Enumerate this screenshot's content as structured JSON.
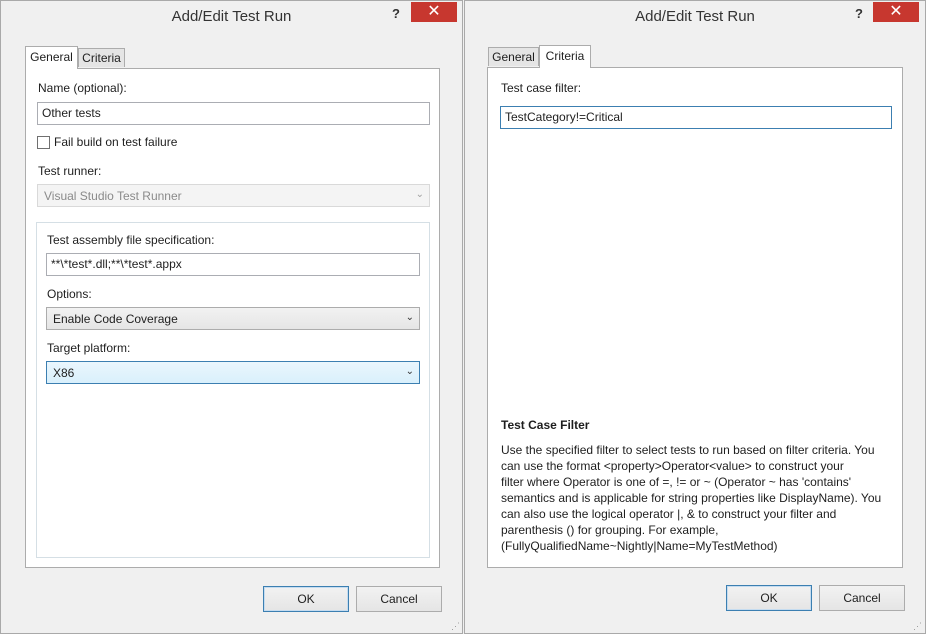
{
  "left_dialog": {
    "title": "Add/Edit Test Run",
    "help_glyph": "?",
    "close_glyph": "✕",
    "tabs": [
      {
        "label": "General",
        "active": true
      },
      {
        "label": "Criteria",
        "active": false
      }
    ],
    "name_label": "Name (optional):",
    "name_value": "Other tests",
    "fail_build_label": "Fail build on test failure",
    "fail_build_checked": false,
    "test_runner_label": "Test runner:",
    "test_runner_value": "Visual Studio Test Runner",
    "assembly_spec_label": "Test assembly file specification:",
    "assembly_spec_value": "**\\*test*.dll;**\\*test*.appx",
    "options_label": "Options:",
    "options_value": "Enable Code Coverage",
    "target_platform_label": "Target platform:",
    "target_platform_value": "X86",
    "ok_label": "OK",
    "cancel_label": "Cancel"
  },
  "right_dialog": {
    "title": "Add/Edit Test Run",
    "help_glyph": "?",
    "close_glyph": "✕",
    "tabs": [
      {
        "label": "General",
        "active": false
      },
      {
        "label": "Criteria",
        "active": true
      }
    ],
    "filter_label": "Test case filter:",
    "filter_value": "TestCategory!=Critical",
    "help_title": "Test Case Filter",
    "help_lines": [
      "Use the specified filter to select tests to run based on filter criteria. You",
      "can use the format <property>Operator<value> to construct your",
      "filter where Operator is one of =, != or ~  (Operator ~ has 'contains'",
      "semantics and is applicable for string properties like DisplayName). You",
      "can also use the logical operator |, & to construct your filter and",
      "parenthesis () for grouping. For example,",
      "(FullyQualifiedName~Nightly|Name=MyTestMethod)"
    ],
    "ok_label": "OK",
    "cancel_label": "Cancel"
  },
  "icons": {
    "dropdown_arrow": "⌄",
    "resize_grip": "⋰"
  },
  "colors": {
    "close_button": "#c7372f",
    "focus_border": "#3c7fb1",
    "dialog_background": "#f0f0f0"
  }
}
